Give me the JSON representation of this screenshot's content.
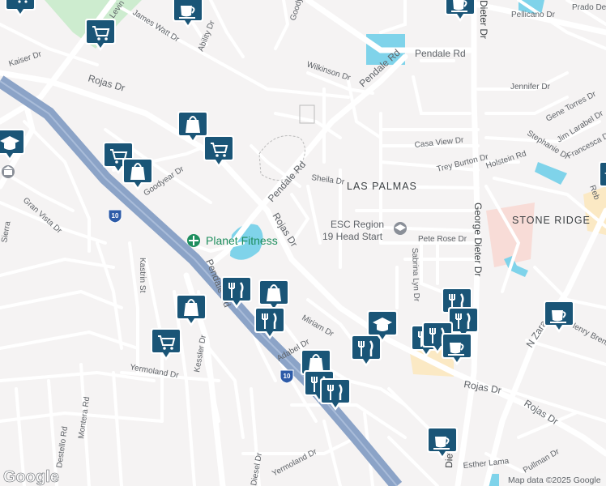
{
  "map": {
    "neighborhoods": {
      "las_palmas": "LAS PALMAS",
      "stone_ridge": "STONE RIDGE"
    },
    "streets": {
      "pellicano": "Pellicano Dr",
      "prado": "Prado Del",
      "pendale_top": "Pendale Rd",
      "pendale_diag": "Pendale Rd",
      "pendale_mid": "Pendale Rd",
      "pendale_lower": "Pendale Rd",
      "wilkinson": "Wilkinson Dr",
      "jennifer": "Jennifer Dr",
      "gene_torres": "Gene Torres Dr",
      "jim_larabel": "Jim Larabel Dr",
      "stephanie": "Stephanie Dr",
      "francesca": "Francesca Dr",
      "casa_view": "Casa View Dr",
      "trey_burton": "Trey Burton Dr",
      "holstein": "Holstein Rd",
      "sheila": "Sheila Dr",
      "george_dieter": "George Dieter Dr",
      "dieter_top": "Dieter Dr",
      "dieter_bottom": "Dieter Dr",
      "pete_rose": "Pete Rose Dr",
      "sabrina_lyn": "Sabrina Lyn Dr",
      "rojas_nw": "Rojas Dr",
      "rojas_mid": "Rojas Dr",
      "rojas_se1": "Rojas Dr",
      "rojas_se2": "Rojas Dr",
      "kaiser": "Kaiser Dr",
      "james_watt": "James Watt Dr",
      "ability": "Ability Dr",
      "goodyear_top": "Goodyear",
      "goodyear": "Goodyear Dr",
      "gran_vista": "Gran Vista Dr",
      "kastrin": "Kastrin St",
      "kessler": "Kessler Dr",
      "miriam": "Miriam Dr",
      "adabel": "Adabel Dr",
      "yermoland_left": "Yermoland Dr",
      "yermoland_bottom": "Yermoland Dr",
      "montera": "Montera Rd",
      "destello": "Destello Rd",
      "diesel": "Diesel Dr",
      "n_zaragoza": "N Zaragoza",
      "henry_brennan": "Henry Brenn",
      "esther_lama": "Esther Lama",
      "pullman": "Pullman Dr",
      "rebecca": "Reb",
      "ene": "ne",
      "levin": "Levin",
      "sierra": "Sierra"
    },
    "highway_shields": [
      "10",
      "10"
    ],
    "places": {
      "planet_fitness": "Planet Fitness",
      "esc_region_line1": "ESC Region",
      "esc_region_line2": "19 Head Start"
    },
    "colors": {
      "background": "#f5f3f3",
      "interstate": "#8ba3c7",
      "water": "#7fd3ea",
      "park": "#cdeccf",
      "pin": "#1a5577",
      "fitness": "#1e8e5e"
    },
    "footer": {
      "logo": "Google",
      "attribution": "Map data ©2025 Google"
    }
  }
}
